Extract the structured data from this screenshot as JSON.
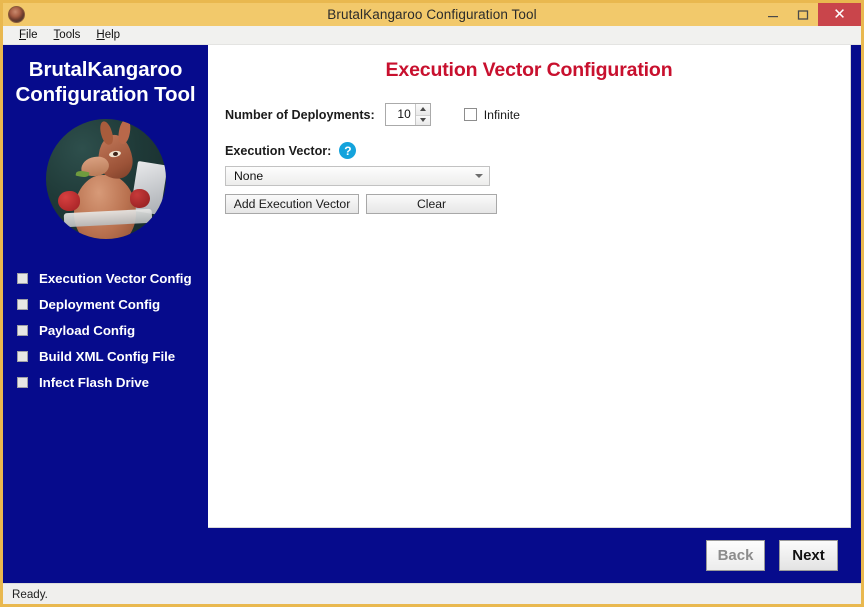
{
  "window": {
    "title": "BrutalKangaroo Configuration Tool",
    "app_icon": "kangaroo-icon",
    "controls": {
      "minimize": "minimize-icon",
      "maximize": "maximize-icon",
      "close": "✕"
    }
  },
  "menu": {
    "items": [
      {
        "mnemonic": "F",
        "rest": "ile"
      },
      {
        "mnemonic": "T",
        "rest": "ools"
      },
      {
        "mnemonic": "H",
        "rest": "elp"
      }
    ]
  },
  "sidebar": {
    "title_line1": "BrutalKangaroo",
    "title_line2": "Configuration Tool",
    "logo": "kangaroo-boxer-logo",
    "items": [
      {
        "label": "Execution Vector Config"
      },
      {
        "label": "Deployment Config"
      },
      {
        "label": "Payload Config"
      },
      {
        "label": "Build XML Config File"
      },
      {
        "label": "Infect Flash Drive"
      }
    ]
  },
  "main": {
    "heading": "Execution Vector Configuration",
    "deployments": {
      "label": "Number of Deployments:",
      "value": "10",
      "up_arrow": "spinner-up-icon",
      "down_arrow": "spinner-down-icon"
    },
    "infinite": {
      "label": "Infinite",
      "checked": false
    },
    "execution_vector": {
      "label": "Execution Vector:",
      "help_glyph": "?",
      "selected": "None",
      "options": [
        "None"
      ]
    },
    "buttons": {
      "add_vector": "Add Execution Vector",
      "clear": "Clear"
    }
  },
  "footer": {
    "back": "Back",
    "next": "Next"
  },
  "status": {
    "text": "Ready."
  },
  "colors": {
    "title_bar": "#F2C96B",
    "navy": "#060B8C",
    "heading_red": "#C8102E",
    "close_red": "#C9454B",
    "help_blue": "#14A3DC"
  }
}
